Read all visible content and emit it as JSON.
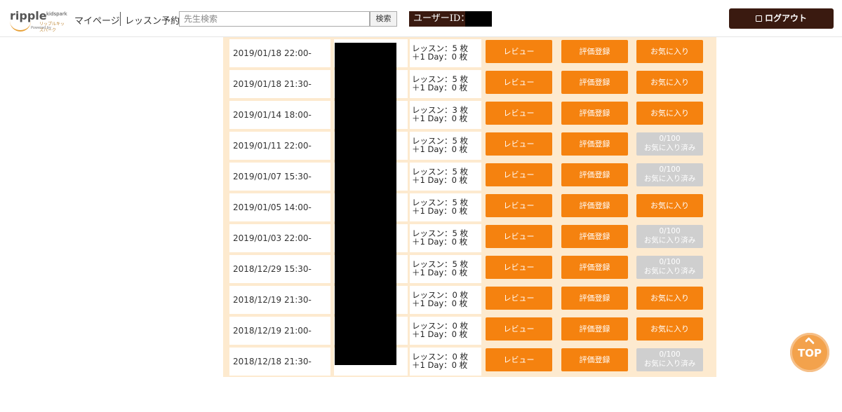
{
  "header": {
    "logo": {
      "main": "ripple",
      "kids": "kidspark",
      "sub": "リップルキッズパーク",
      "powered": "Powered by"
    },
    "nav": {
      "mypage": "マイページ",
      "lesson_booking": "レッスン予約"
    },
    "search": {
      "placeholder": "先生検索",
      "button": "検索"
    },
    "user_id_label": "ユーザーID：",
    "logout": "ログアウト"
  },
  "rows": [
    {
      "date": "2019/01/18 22:00-",
      "ticket_line1": "レッスン：5 枚",
      "ticket_line2": "＋1 Day：0 枚",
      "review": "レビュー",
      "evaluate": "評価登録",
      "favorite": "お気に入り",
      "favorite_done": false
    },
    {
      "date": "2019/01/18 21:30-",
      "ticket_line1": "レッスン：5 枚",
      "ticket_line2": "＋1 Day：0 枚",
      "review": "レビュー",
      "evaluate": "評価登録",
      "favorite": "お気に入り",
      "favorite_done": false
    },
    {
      "date": "2019/01/14 18:00-",
      "ticket_line1": "レッスン：3 枚",
      "ticket_line2": "＋1 Day：0 枚",
      "review": "レビュー",
      "evaluate": "評価登録",
      "favorite": "お気に入り",
      "favorite_done": false
    },
    {
      "date": "2019/01/11 22:00-",
      "ticket_line1": "レッスン：5 枚",
      "ticket_line2": "＋1 Day：0 枚",
      "review": "レビュー",
      "evaluate": "評価登録",
      "favorite_count": "0/100",
      "favorite": "お気に入り済み",
      "favorite_done": true
    },
    {
      "date": "2019/01/07 15:30-",
      "ticket_line1": "レッスン：5 枚",
      "ticket_line2": "＋1 Day：0 枚",
      "review": "レビュー",
      "evaluate": "評価登録",
      "favorite_count": "0/100",
      "favorite": "お気に入り済み",
      "favorite_done": true
    },
    {
      "date": "2019/01/05 14:00-",
      "ticket_line1": "レッスン：5 枚",
      "ticket_line2": "＋1 Day：0 枚",
      "review": "レビュー",
      "evaluate": "評価登録",
      "favorite": "お気に入り",
      "favorite_done": false
    },
    {
      "date": "2019/01/03 22:00-",
      "ticket_line1": "レッスン：5 枚",
      "ticket_line2": "＋1 Day：0 枚",
      "review": "レビュー",
      "evaluate": "評価登録",
      "favorite_count": "0/100",
      "favorite": "お気に入り済み",
      "favorite_done": true
    },
    {
      "date": "2018/12/29 15:30-",
      "ticket_line1": "レッスン：5 枚",
      "ticket_line2": "＋1 Day：0 枚",
      "review": "レビュー",
      "evaluate": "評価登録",
      "favorite_count": "0/100",
      "favorite": "お気に入り済み",
      "favorite_done": true
    },
    {
      "date": "2018/12/19 21:30-",
      "ticket_line1": "レッスン：0 枚",
      "ticket_line2": "＋1 Day：0 枚",
      "review": "レビュー",
      "evaluate": "評価登録",
      "favorite": "お気に入り",
      "favorite_done": false
    },
    {
      "date": "2018/12/19 21:00-",
      "ticket_line1": "レッスン：0 枚",
      "ticket_line2": "＋1 Day：0 枚",
      "review": "レビュー",
      "evaluate": "評価登録",
      "favorite": "お気に入り",
      "favorite_done": false
    },
    {
      "date": "2018/12/18 21:30-",
      "ticket_line1": "レッスン：0 枚",
      "ticket_line2": "＋1 Day：0 枚",
      "review": "レビュー",
      "evaluate": "評価登録",
      "favorite_count": "0/100",
      "favorite": "お気に入り済み",
      "favorite_done": true
    }
  ],
  "top_button": "TOP",
  "colors": {
    "accent": "#f5820f",
    "brand_dark": "#3a1a10",
    "panel_bg": "#fdeacf",
    "disabled": "#cfcfcf"
  },
  "icons": {
    "logout": "logout-icon",
    "top": "arrow-up-icon"
  }
}
